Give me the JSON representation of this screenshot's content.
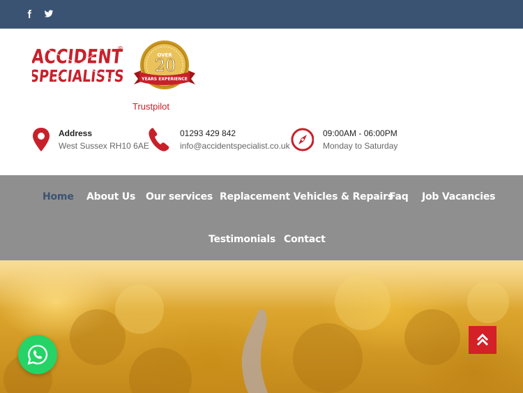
{
  "topbar": {
    "social": [
      {
        "name": "facebook-icon"
      },
      {
        "name": "twitter-icon"
      }
    ]
  },
  "header": {
    "logo_text_line1": "ACCIDENT",
    "logo_text_line2": "SPECIALISTS",
    "logo_registered": "®",
    "badge": {
      "top": "OVER",
      "number": "20",
      "ribbon": "YEARS EXPERIENCE"
    },
    "trustpilot": "Trustpilot",
    "info": [
      {
        "icon": "map-pin-icon",
        "title": "Address",
        "detail": "West Sussex RH10 6AE"
      },
      {
        "icon": "phone-icon",
        "title": "01293 429 842",
        "detail": "info@accidentspecialist.co.uk"
      },
      {
        "icon": "compass-icon",
        "title": "09:00AM - 06:00PM",
        "detail": "Monday to Saturday"
      }
    ]
  },
  "nav": {
    "items": [
      {
        "label": "Home",
        "active": true
      },
      {
        "label": "About Us"
      },
      {
        "label": "Our services"
      },
      {
        "label": "Replacement Vehicles & Repairs"
      },
      {
        "label": "Faq"
      },
      {
        "label": "Job Vacancies"
      },
      {
        "label": "Testimonials"
      },
      {
        "label": "Contact"
      }
    ]
  },
  "floating": {
    "whatsapp_icon": "whatsapp-icon",
    "scroll_top_icon": "double-chevron-up-icon"
  },
  "colors": {
    "topbar": "#3b5372",
    "nav_bg": "#8f8f8f",
    "accent_red": "#d42027",
    "whatsapp_green": "#25d366"
  }
}
